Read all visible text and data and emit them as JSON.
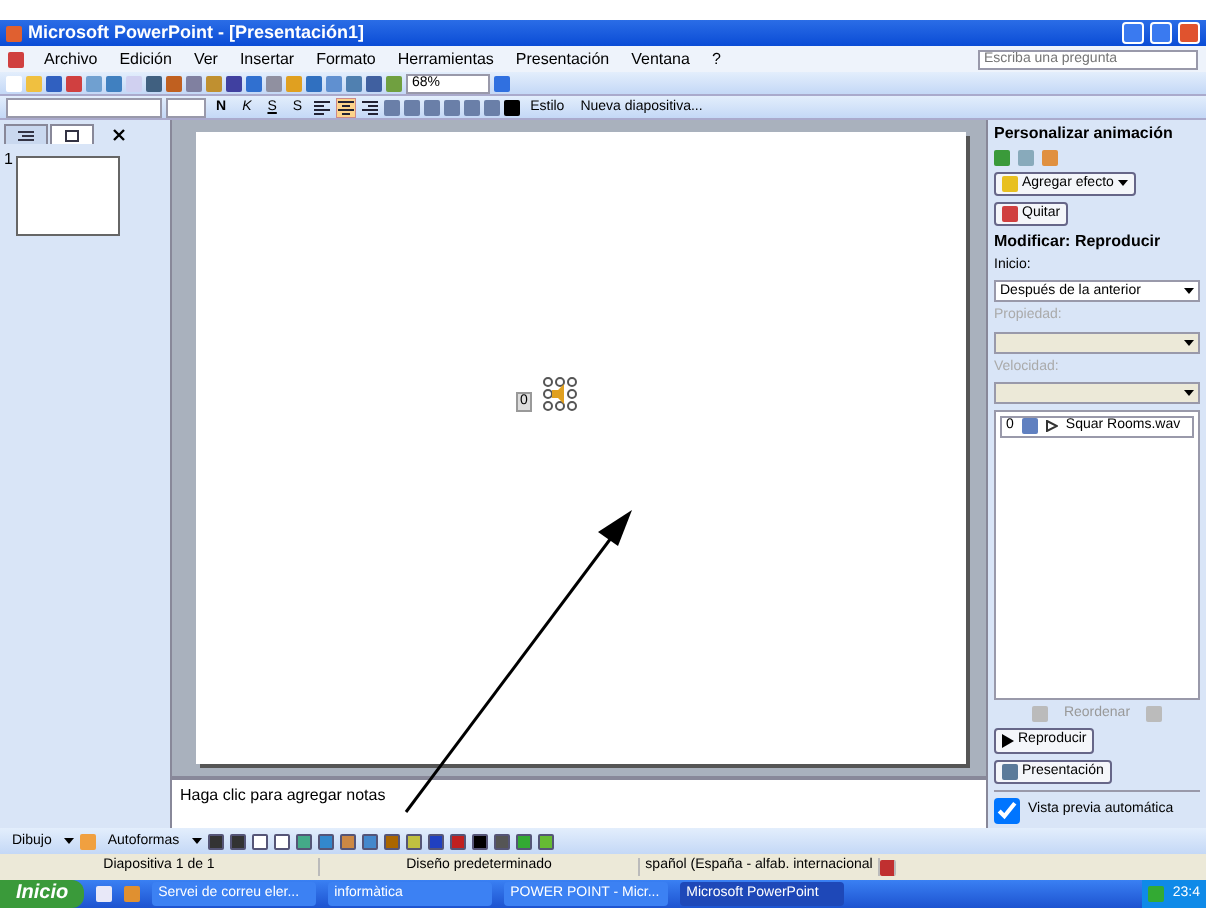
{
  "window": {
    "title": "Microsoft PowerPoint - [Presentación1]"
  },
  "menu": [
    "Archivo",
    "Edición",
    "Ver",
    "Insertar",
    "Formato",
    "Herramientas",
    "Presentación",
    "Ventana",
    "?"
  ],
  "help_box": {
    "placeholder": "Escriba una pregunta"
  },
  "standard_toolbar": {
    "zoom": "68%"
  },
  "formatting_toolbar": {
    "style_buttons": [
      "N",
      "K",
      "S",
      "S"
    ],
    "alignment": [
      {
        "kind": "left",
        "selected": false
      },
      {
        "kind": "center",
        "selected": true
      },
      {
        "kind": "right",
        "selected": false
      }
    ],
    "buttons": [
      "Estilo",
      "Nueva diapositiva..."
    ]
  },
  "slides_pane": {
    "tabs": [
      {
        "kind": "outline",
        "selected": false
      },
      {
        "kind": "slides",
        "selected": true
      }
    ],
    "slide_number": "1"
  },
  "slide": {
    "marker": "0"
  },
  "notes": {
    "text": "Haga clic para agregar notas"
  },
  "task_pane": {
    "title": "Personalizar animación",
    "add_effect": "Agregar efecto",
    "remove": "Quitar",
    "heading": "Modificar: Reproducir",
    "fields": [
      {
        "label": "Inicio:",
        "value": "Después de la anterior",
        "disabled": false
      },
      {
        "label": "Propiedad:",
        "disabled": true
      },
      {
        "label": "Velocidad:",
        "disabled": true
      }
    ],
    "animations": [
      {
        "order": "0",
        "name": "Squar Rooms.wav"
      }
    ],
    "reorder": "Reordenar",
    "play": "Reproducir",
    "slideshow": "Presentación",
    "preview": {
      "label": "Vista previa automática",
      "checked": true
    }
  },
  "drawing_toolbar": {
    "draw": "Dibujo",
    "autoshapes": "Autoformas"
  },
  "status_bar": [
    "Diapositiva 1 de 1",
    "Diseño predeterminado",
    "spañol (España - alfab. internacional"
  ],
  "taskbar": {
    "start": "Inicio",
    "buttons": [
      {
        "label": "Servei de correu eler...",
        "selected": false
      },
      {
        "label": "informàtica",
        "selected": false
      },
      {
        "label": "POWER POINT - Micr...",
        "selected": false
      },
      {
        "label": "Microsoft PowerPoint",
        "selected": true
      }
    ],
    "clock": "23:4"
  }
}
